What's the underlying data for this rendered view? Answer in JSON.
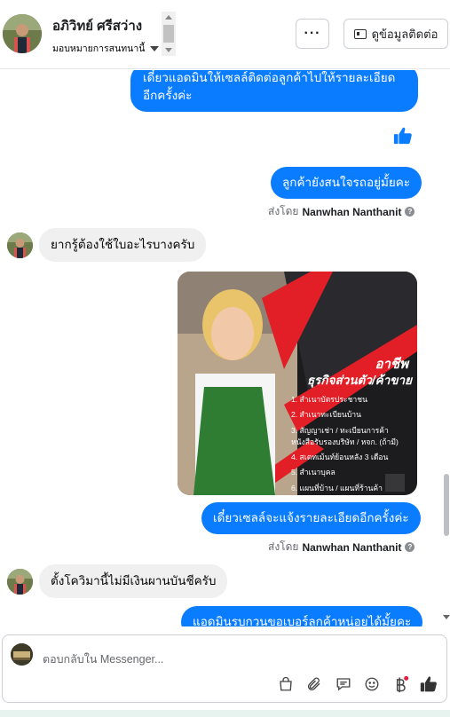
{
  "header": {
    "contact_name": "อภิวิทย์ ศรีสว่าง",
    "assign_label": "มอบหมายการสนทนานี้",
    "more_label": "···",
    "view_contact_label": "ดูข้อมูลติดต่อ"
  },
  "messages": [
    {
      "type": "outgoing",
      "text_line1": "เดี๋ยวแอดมินให้เซลล์ติดต่อลูกค้าไปให้รายละเอียด",
      "text_line2": "อีกครั้งค่ะ"
    },
    {
      "type": "outgoing-like"
    },
    {
      "type": "outgoing",
      "text": "ลูกค้ายังสนใจรถอยู่มั้ยคะ"
    },
    {
      "type": "sent-by",
      "prefix": "ส่งโดย",
      "name": "Nanwhan Nanthanit"
    },
    {
      "type": "incoming",
      "text": "ยากรู้ต้องใช้ใบอะไรบางครับ"
    },
    {
      "type": "outgoing-image"
    },
    {
      "type": "outgoing",
      "text": "เดี๋ยวเซลล์จะแจ้งรายละเอียดอีกครั้งค่ะ"
    },
    {
      "type": "sent-by",
      "prefix": "ส่งโดย",
      "name": "Nanwhan Nanthanit"
    },
    {
      "type": "incoming",
      "text": "ตั้งโควิมานี้ไม่มีเงินผานบันชีครับ"
    },
    {
      "type": "outgoing",
      "text": "แอดมินรบกวนขอเบอร์ลูกค้าหน่อยได้มั้ยคะ"
    }
  ],
  "image_card": {
    "title1": "อาชีพ",
    "title2": "ธุรกิจส่วนตัว/ค้าขาย",
    "items": [
      "1. สำเนาบัตรประชาชน",
      "2. สำเนาทะเบียนบ้าน",
      "3. สัญญาเช่า / ทะเบียนการค้า",
      "หนังสือรับรองบริษัท / หจก. (ถ้ามี)",
      "4. สเตทเม้นท์ย้อนหลัง 3 เดือน",
      "5. สำเนาบุคล",
      "6. แผนที่บ้าน / แผนที่ร้านค้า"
    ]
  },
  "composer": {
    "placeholder": "ตอบกลับใน Messenger..."
  },
  "colors": {
    "accent": "#0a7cff",
    "incoming_bubble": "#f0f0f0",
    "image_red": "#e21f26"
  },
  "icons": [
    "bag-icon",
    "attach-icon",
    "saved-replies-icon",
    "emoji-icon",
    "payment-icon",
    "like-icon"
  ]
}
